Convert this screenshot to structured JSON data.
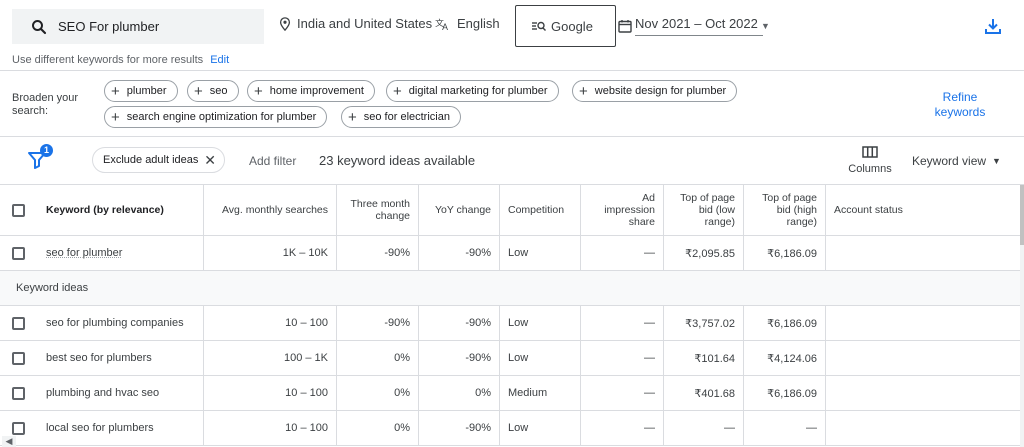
{
  "search": {
    "value": "SEO For plumber"
  },
  "location": {
    "label": "India and United States",
    "icon": "location-pin-icon"
  },
  "language": {
    "label": "English",
    "icon": "translate-icon"
  },
  "network": {
    "label": "Google",
    "icon": "search-network-icon"
  },
  "date_range": {
    "label": "Nov 2021 – Oct 2022",
    "icon": "calendar-icon"
  },
  "hint": {
    "text": "Use different keywords for more results",
    "edit_label": "Edit"
  },
  "broaden": {
    "label": "Broaden your search:",
    "chips": [
      "plumber",
      "seo",
      "home improvement",
      "digital marketing for plumber",
      "website design for plumber",
      "search engine optimization for plumber",
      "seo for electrician"
    ],
    "refine_label": "Refine keywords"
  },
  "filters": {
    "badge_count": "1",
    "adult_chip_label": "Exclude adult ideas",
    "add_filter_label": "Add filter",
    "ideas_count": "23 keyword ideas available",
    "columns_label": "Columns",
    "keyword_view_label": "Keyword view"
  },
  "table": {
    "headers": [
      "Keyword (by relevance)",
      "Avg. monthly searches",
      "Three month change",
      "YoY change",
      "Competition",
      "Ad impression share",
      "Top of page bid (low range)",
      "Top of page bid (high range)",
      "Account status"
    ],
    "provided_row": [
      "seo for plumber",
      "1K – 10K",
      "-90%",
      "-90%",
      "Low",
      "—",
      "₹2,095.85",
      "₹6,186.09",
      ""
    ],
    "group_label": "Keyword ideas",
    "rows": [
      [
        "seo for plumbing companies",
        "10 – 100",
        "-90%",
        "-90%",
        "Low",
        "—",
        "₹3,757.02",
        "₹6,186.09",
        ""
      ],
      [
        "best seo for plumbers",
        "100 – 1K",
        "0%",
        "-90%",
        "Low",
        "—",
        "₹101.64",
        "₹4,124.06",
        ""
      ],
      [
        "plumbing and hvac seo",
        "10 – 100",
        "0%",
        "0%",
        "Medium",
        "—",
        "₹401.68",
        "₹6,186.09",
        ""
      ],
      [
        "local seo for plumbers",
        "10 – 100",
        "0%",
        "-90%",
        "Low",
        "—",
        "—",
        "—",
        ""
      ]
    ]
  },
  "colors": {
    "accent": "#1a73e8",
    "text": "#3c4043",
    "border": "#dadce0"
  }
}
